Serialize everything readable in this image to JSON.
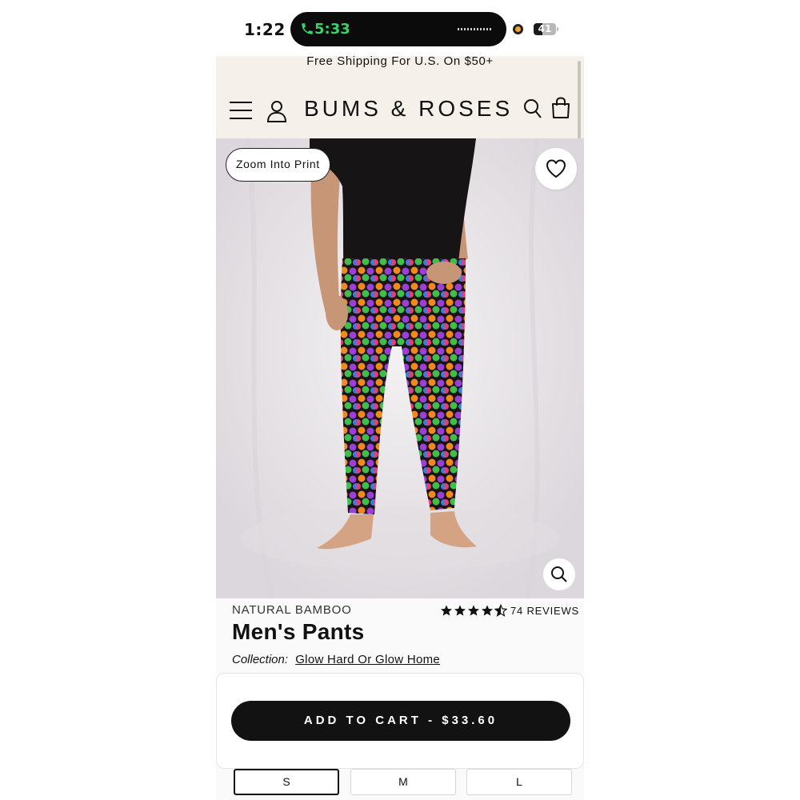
{
  "status_bar": {
    "time": "1:22",
    "call_duration": "5:33",
    "battery_level": "41",
    "battery_fraction": 0.41
  },
  "header": {
    "announcement": "Free Shipping For U.S. On $50+",
    "logo": "BUMS & ROSES"
  },
  "product_image": {
    "zoom_into_print": "Zoom Into Print"
  },
  "product": {
    "material": "NATURAL BAMBOO",
    "rating": 4.5,
    "reviews": "74 REVIEWS",
    "title": "Men's Pants",
    "collection_label": "Collection:",
    "collection_name": "Glow Hard Or Glow Home"
  },
  "cart": {
    "add_to_cart": "ADD TO CART - $33.60"
  },
  "sizes": {
    "selected": "S",
    "options": [
      "S",
      "M",
      "L"
    ]
  },
  "colors": {
    "header_bg": "#f5f1ea",
    "cart_button": "#121212",
    "call_green": "#35d46a"
  }
}
